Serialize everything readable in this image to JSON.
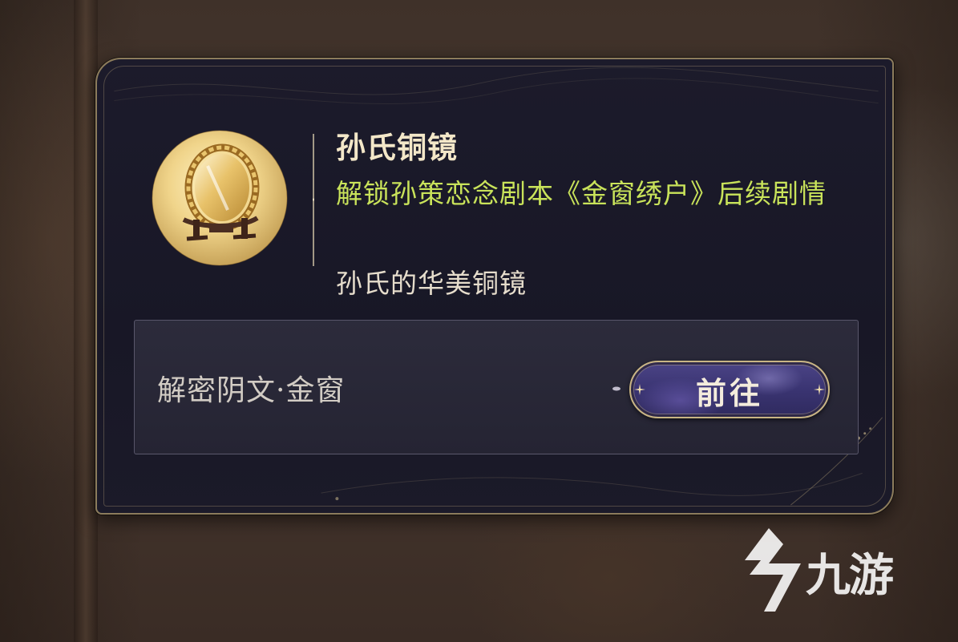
{
  "item": {
    "name": "孙氏铜镜",
    "effect": "解锁孙策恋念剧本《金窗绣户》后续剧情",
    "description": "孙氏的华美铜镜",
    "icon": "bronze-mirror-icon"
  },
  "source": {
    "label": "解密阴文·金窗",
    "button_label": "前往"
  },
  "watermark": {
    "text": "九游",
    "icon": "jiuyou-logo-icon"
  },
  "colors": {
    "title": "#f3e7c8",
    "effect": "#c9e35a",
    "description": "#e6ddcc",
    "panel_border": "#8c7c5c",
    "button": "#3a3472"
  }
}
